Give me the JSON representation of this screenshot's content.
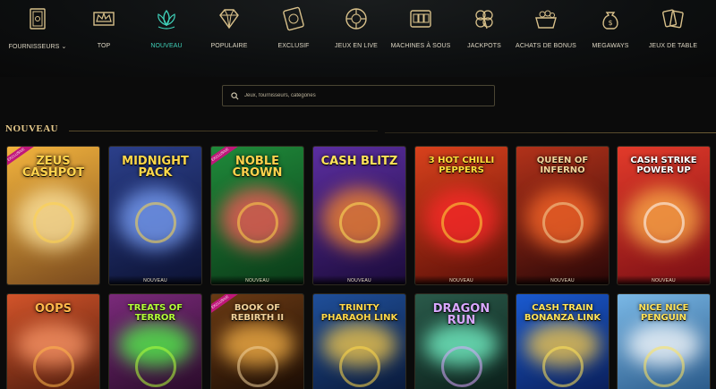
{
  "nav": {
    "items": [
      {
        "label": "FOURNISSEURS",
        "icon": "providers-book-icon",
        "dropdown": true
      },
      {
        "label": "TOP",
        "icon": "crown-icon"
      },
      {
        "label": "NOUVEAU",
        "icon": "lotus-icon",
        "active": true
      },
      {
        "label": "POPULAIRE",
        "icon": "diamond-icon"
      },
      {
        "label": "EXCLUSIF",
        "icon": "exclusive-ticket-icon"
      },
      {
        "label": "JEUX EN LIVE",
        "icon": "roulette-chip-icon"
      },
      {
        "label": "MACHINES À SOUS",
        "icon": "slot-machine-icon"
      },
      {
        "label": "JACKPOTS",
        "icon": "clover-icon"
      },
      {
        "label": "ACHATS DE BONUS",
        "icon": "bonus-basket-icon"
      },
      {
        "label": "MEGAWAYS",
        "icon": "money-bag-icon"
      },
      {
        "label": "JEUX DE TABLE",
        "icon": "playing-cards-icon"
      }
    ]
  },
  "search": {
    "placeholder": "Jeux, fournisseurs, catégories"
  },
  "section": {
    "title": "NOUVEAU"
  },
  "badges": {
    "new": "NOUVEAU",
    "exclusive": "EXCLUSIVE"
  },
  "games_row1": [
    {
      "title": "ZEUS CASHPOT",
      "bg1": "#f2b33d",
      "bg2": "#7a4a1e",
      "glow": "#ffe7a3",
      "color": "#ffd34d",
      "exclusive": true,
      "new": false
    },
    {
      "title": "MIDNIGHT PACK",
      "bg1": "#2b3f8a",
      "bg2": "#0c1233",
      "glow": "#7ea6ff",
      "color": "#ffd84a",
      "exclusive": false,
      "new": true
    },
    {
      "title": "NOBLE CROWN",
      "bg1": "#1f8a3a",
      "bg2": "#0b3a18",
      "glow": "#ff5a5a",
      "color": "#ffd34d",
      "exclusive": true,
      "new": true
    },
    {
      "title": "CASH BLITZ",
      "bg1": "#5b2ea0",
      "bg2": "#1b0b3a",
      "glow": "#ff8a2a",
      "color": "#ffe35a",
      "exclusive": false,
      "new": true
    },
    {
      "title": "3 HOT CHILLI PEPPERS",
      "bg1": "#d8411c",
      "bg2": "#5a0f08",
      "glow": "#ff2a2a",
      "color": "#ffde3a",
      "exclusive": false,
      "new": true
    },
    {
      "title": "QUEEN OF INFERNO",
      "bg1": "#b2321a",
      "bg2": "#2a0707",
      "glow": "#ff6a2a",
      "color": "#f4d59a",
      "exclusive": false,
      "new": true
    },
    {
      "title": "CASH STRIKE POWER UP",
      "bg1": "#e23a2a",
      "bg2": "#7a0f14",
      "glow": "#ffb14a",
      "color": "#ffffff",
      "exclusive": false,
      "new": true
    }
  ],
  "games_row2": [
    {
      "title": "OOPS",
      "bg1": "#d3542a",
      "bg2": "#4a1a0c",
      "glow": "#ff9a6a",
      "color": "#ffb74a",
      "exclusive": false
    },
    {
      "title": "TREATS OF TERROR",
      "bg1": "#7a2a7a",
      "bg2": "#2a0b2a",
      "glow": "#53ff4a",
      "color": "#b5ff3a",
      "exclusive": false
    },
    {
      "title": "BOOK OF REBIRTH II",
      "bg1": "#6a3a14",
      "bg2": "#1a0c04",
      "glow": "#ffb84a",
      "color": "#f2d29a",
      "exclusive": true
    },
    {
      "title": "TRINITY PHARAOH LINK",
      "bg1": "#1f4f9a",
      "bg2": "#0a1a3a",
      "glow": "#ffd04a",
      "color": "#ffd84a",
      "exclusive": false
    },
    {
      "title": "DRAGON RUN",
      "bg1": "#2a5a4a",
      "bg2": "#0b1f1a",
      "glow": "#7affd0",
      "color": "#d9a7ff",
      "exclusive": false
    },
    {
      "title": "CASH TRAIN BONANZA LINK",
      "bg1": "#1a5ad0",
      "bg2": "#0a1f5a",
      "glow": "#ffd04a",
      "color": "#ffe35a",
      "exclusive": false
    },
    {
      "title": "NICE NICE PENGUIN",
      "bg1": "#7ab8e6",
      "bg2": "#2a5a8a",
      "glow": "#ffffff",
      "color": "#ffe35a",
      "exclusive": false
    }
  ]
}
